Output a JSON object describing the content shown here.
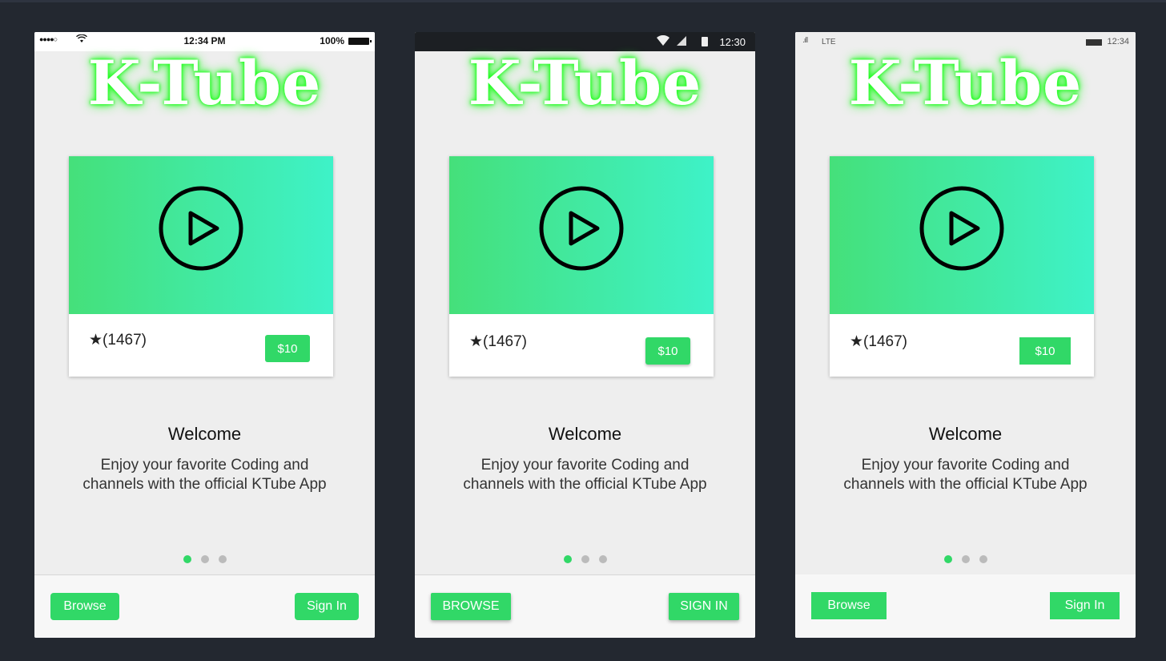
{
  "colors": {
    "background": "#232830",
    "accent": "#31d867",
    "gradient_start": "#45e07a",
    "gradient_end": "#3ef2c8",
    "logo_glow": "#1aff1a"
  },
  "phones": {
    "ios": {
      "status": {
        "signal": "●●●●○",
        "time": "12:34 PM",
        "battery": "100%"
      },
      "logo": "K-Tube",
      "card": {
        "star": "★",
        "rating_count": "(1467)",
        "price": "$10"
      },
      "welcome": "Welcome",
      "description_line1": "Enjoy your favorite Coding and",
      "description_line2": "channels with the official KTube App",
      "page_indicator": {
        "total": 3,
        "active": 1
      },
      "buttons": {
        "browse": "Browse",
        "sign_in": "Sign In"
      }
    },
    "android": {
      "status": {
        "time": "12:30"
      },
      "logo": "K-Tube",
      "card": {
        "star": "★",
        "rating_count": "(1467)",
        "price": "$10"
      },
      "welcome": "Welcome",
      "description_line1": "Enjoy your favorite Coding and",
      "description_line2": "channels with the official KTube App",
      "page_indicator": {
        "total": 3,
        "active": 1
      },
      "buttons": {
        "browse": "BROWSE",
        "sign_in": "SIGN IN"
      }
    },
    "windows": {
      "status": {
        "signal": ".ıll",
        "network": "LTE",
        "time": "12:34"
      },
      "logo": "K-Tube",
      "card": {
        "star": "★",
        "rating_count": "(1467)",
        "price": "$10"
      },
      "welcome": "Welcome",
      "description_line1": "Enjoy your favorite Coding and",
      "description_line2": "channels with the official KTube App",
      "page_indicator": {
        "total": 3,
        "active": 1
      },
      "buttons": {
        "browse": "Browse",
        "sign_in": "Sign In"
      }
    }
  },
  "icons": {
    "play": "play-circle-icon",
    "wifi": "wifi-icon",
    "battery": "battery-icon",
    "cell": "cell-signal-icon"
  }
}
